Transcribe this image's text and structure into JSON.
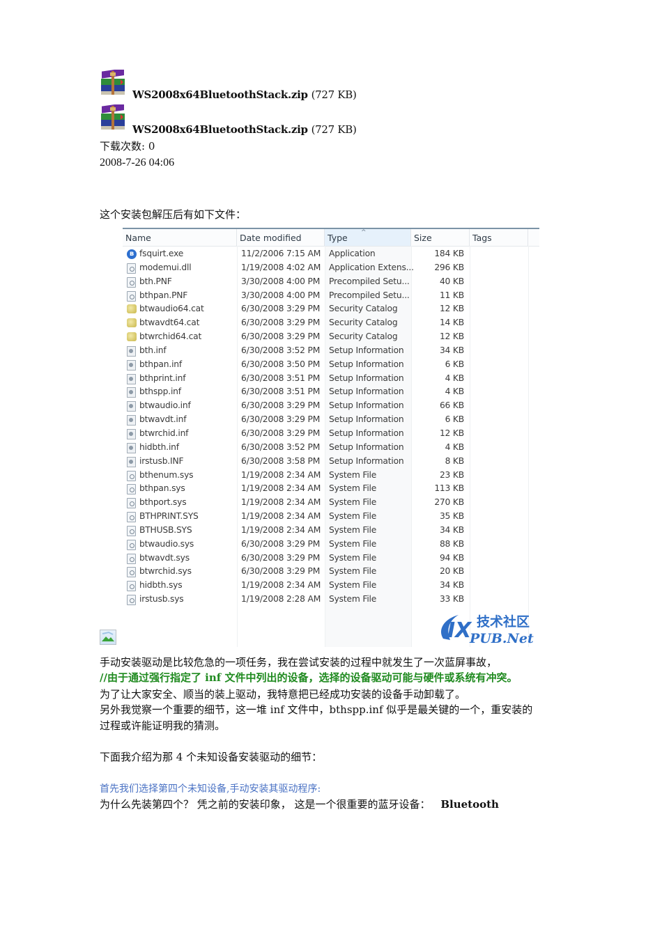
{
  "attachments": [
    {
      "icon": "winrar-archive-icon",
      "filename": "WS2008x64BluetoothStack.zip",
      "size": "(727  KB)"
    },
    {
      "icon": "winrar-archive-icon",
      "filename": "WS2008x64BluetoothStack.zip",
      "size": "(727  KB)"
    }
  ],
  "download_count": "下载次数: 0",
  "posted_time": "2008-7-26 04:06",
  "intro": "这个安装包解压后有如下文件：",
  "explorer": {
    "columns": [
      "Name",
      "Date modified",
      "Type",
      "Size",
      "Tags"
    ],
    "sorted_column": "Type",
    "files": [
      {
        "icon": "bluetooth",
        "name": "fsquirt.exe",
        "date": "11/2/2006 7:15 AM",
        "type": "Application",
        "size": "184 KB"
      },
      {
        "icon": "file",
        "name": "modemui.dll",
        "date": "1/19/2008 4:02 AM",
        "type": "Application Extens...",
        "size": "296 KB"
      },
      {
        "icon": "file",
        "name": "bth.PNF",
        "date": "3/30/2008 4:00 PM",
        "type": "Precompiled Setu...",
        "size": "40 KB"
      },
      {
        "icon": "file",
        "name": "bthpan.PNF",
        "date": "3/30/2008 4:00 PM",
        "type": "Precompiled Setu...",
        "size": "11 KB"
      },
      {
        "icon": "catalog",
        "name": "btwaudio64.cat",
        "date": "6/30/2008 3:29 PM",
        "type": "Security Catalog",
        "size": "12 KB"
      },
      {
        "icon": "catalog",
        "name": "btwavdt64.cat",
        "date": "6/30/2008 3:29 PM",
        "type": "Security Catalog",
        "size": "14 KB"
      },
      {
        "icon": "catalog",
        "name": "btwrchid64.cat",
        "date": "6/30/2008 3:29 PM",
        "type": "Security Catalog",
        "size": "12 KB"
      },
      {
        "icon": "inf",
        "name": "bth.inf",
        "date": "6/30/2008 3:52 PM",
        "type": "Setup Information",
        "size": "34 KB"
      },
      {
        "icon": "inf",
        "name": "bthpan.inf",
        "date": "6/30/2008 3:50 PM",
        "type": "Setup Information",
        "size": "6 KB"
      },
      {
        "icon": "inf",
        "name": "bthprint.inf",
        "date": "6/30/2008 3:51 PM",
        "type": "Setup Information",
        "size": "4 KB"
      },
      {
        "icon": "inf",
        "name": "bthspp.inf",
        "date": "6/30/2008 3:51 PM",
        "type": "Setup Information",
        "size": "4 KB"
      },
      {
        "icon": "inf",
        "name": "btwaudio.inf",
        "date": "6/30/2008 3:29 PM",
        "type": "Setup Information",
        "size": "66 KB"
      },
      {
        "icon": "inf",
        "name": "btwavdt.inf",
        "date": "6/30/2008 3:29 PM",
        "type": "Setup Information",
        "size": "6 KB"
      },
      {
        "icon": "inf",
        "name": "btwrchid.inf",
        "date": "6/30/2008 3:29 PM",
        "type": "Setup Information",
        "size": "12 KB"
      },
      {
        "icon": "inf",
        "name": "hidbth.inf",
        "date": "6/30/2008 3:52 PM",
        "type": "Setup Information",
        "size": "4 KB"
      },
      {
        "icon": "inf",
        "name": "irstusb.INF",
        "date": "6/30/2008 3:58 PM",
        "type": "Setup Information",
        "size": "8 KB"
      },
      {
        "icon": "file",
        "name": "bthenum.sys",
        "date": "1/19/2008 2:34 AM",
        "type": "System File",
        "size": "23 KB"
      },
      {
        "icon": "file",
        "name": "bthpan.sys",
        "date": "1/19/2008 2:34 AM",
        "type": "System File",
        "size": "113 KB"
      },
      {
        "icon": "file",
        "name": "bthport.sys",
        "date": "1/19/2008 2:34 AM",
        "type": "System File",
        "size": "270 KB"
      },
      {
        "icon": "file",
        "name": "BTHPRINT.SYS",
        "date": "1/19/2008 2:34 AM",
        "type": "System File",
        "size": "35 KB"
      },
      {
        "icon": "file",
        "name": "BTHUSB.SYS",
        "date": "1/19/2008 2:34 AM",
        "type": "System File",
        "size": "34 KB"
      },
      {
        "icon": "file",
        "name": "btwaudio.sys",
        "date": "6/30/2008 3:29 PM",
        "type": "System File",
        "size": "88 KB"
      },
      {
        "icon": "file",
        "name": "btwavdt.sys",
        "date": "6/30/2008 3:29 PM",
        "type": "System File",
        "size": "94 KB"
      },
      {
        "icon": "file",
        "name": "btwrchid.sys",
        "date": "6/30/2008 3:29 PM",
        "type": "System File",
        "size": "20 KB"
      },
      {
        "icon": "file",
        "name": "hidbth.sys",
        "date": "1/19/2008 2:34 AM",
        "type": "System File",
        "size": "34 KB"
      },
      {
        "icon": "file",
        "name": "irstusb.sys",
        "date": "1/19/2008 2:28 AM",
        "type": "System File",
        "size": "33 KB"
      }
    ],
    "watermark": {
      "left": "IX",
      "cn": "技术社区",
      "right": "PUB.Net"
    }
  },
  "body": {
    "p1": "手动安装驱动是比较危急的一项任务，我在尝试安装的过程中就发生了一次蓝屏事故，",
    "p2_green": "//由于通过强行指定了  inf 文件中列出的设备，选择的设备驱动可能与硬件或系统有冲突。",
    "p3": "为了让大家安全、顺当的装上驱动，我特意把已经成功安装的设备手动卸载了。",
    "p4_line1": "另外我觉察一个重要的细节，这一堆 inf 文件中，bthspp.inf 似乎是最关键的一个，重安装的",
    "p4_line2": "过程或许能证明我的猜测。",
    "p5": "下面我介绍为那 4 个未知设备安装驱动的细节：",
    "p6_blue": "首先我们选择第四个未知设备,手动安装其驱动程序:",
    "p7": "为什么先装第四个？  凭之前的安装印象，  这是一个很重要的蓝牙设备：",
    "p7_bold": "Bluetooth"
  },
  "colors": {
    "green_text": "#1f8a1f",
    "blue_text": "#4a72c4",
    "watermark_blue": "#2f6fc7"
  }
}
